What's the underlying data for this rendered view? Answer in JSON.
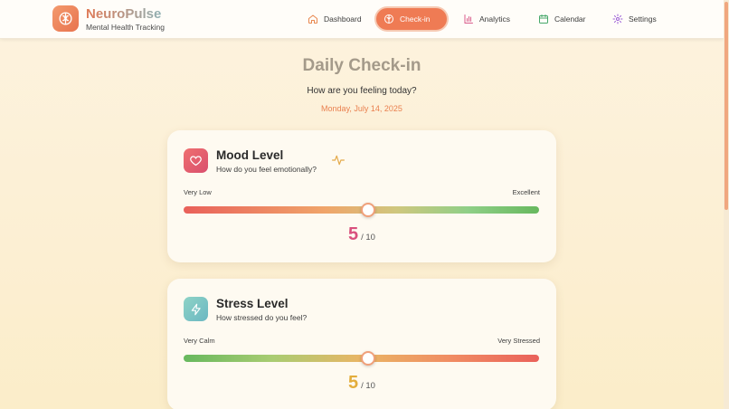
{
  "header": {
    "brand_title": "NeuroPulse",
    "brand_subtitle": "Mental Health Tracking",
    "nav": [
      {
        "label": "Dashboard",
        "icon": "home-icon",
        "active": false
      },
      {
        "label": "Check-in",
        "icon": "brain-icon",
        "active": true
      },
      {
        "label": "Analytics",
        "icon": "bar-chart-icon",
        "active": false
      },
      {
        "label": "Calendar",
        "icon": "calendar-icon",
        "active": false
      },
      {
        "label": "Settings",
        "icon": "gear-icon",
        "active": false
      }
    ]
  },
  "page": {
    "title": "Daily Check-in",
    "question": "How are you feeling today?",
    "date": "Monday, July 14, 2025"
  },
  "mood": {
    "title": "Mood Level",
    "subtitle": "How do you feel emotionally?",
    "label_low": "Very Low",
    "label_high": "Excellent",
    "value": "5",
    "max": "/ 10",
    "icon": "heart-icon",
    "accent": "#d9507d"
  },
  "stress": {
    "title": "Stress Level",
    "subtitle": "How stressed do you feel?",
    "label_low": "Very Calm",
    "label_high": "Very Stressed",
    "value": "5",
    "max": "/ 10",
    "icon": "lightning-icon",
    "accent": "#e3ad3c"
  },
  "colors": {
    "primary": "#ef7b54",
    "background": "#fdf3df"
  }
}
